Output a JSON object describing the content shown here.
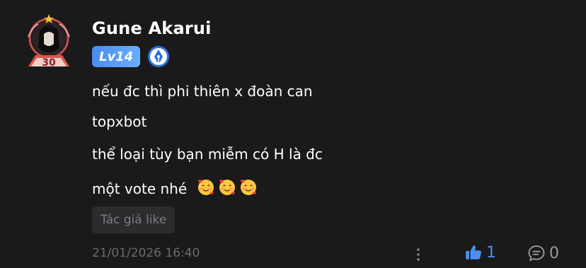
{
  "comment": {
    "author": "Gune Akarui",
    "level_badge": "Lv14",
    "author_badge_icon": "pen-nib-icon",
    "avatar_frame_number": "30",
    "lines": [
      "nếu đc thì phi thiên x đoàn can",
      "topxbot",
      "thể loại tùy bạn miễm có H là đc",
      "một vote nhé"
    ],
    "emoji_count": 3,
    "emoji_icon": "smiling-face-with-hearts-icon",
    "author_like_label": "Tác giả like",
    "timestamp": "21/01/2026 16:40",
    "like_count": "1",
    "comment_count": "0"
  },
  "colors": {
    "background": "#1a1a1b",
    "accent_blue": "#4a90f0",
    "muted_text": "#6a6a6e",
    "chip_bg": "#2c2c2e"
  }
}
